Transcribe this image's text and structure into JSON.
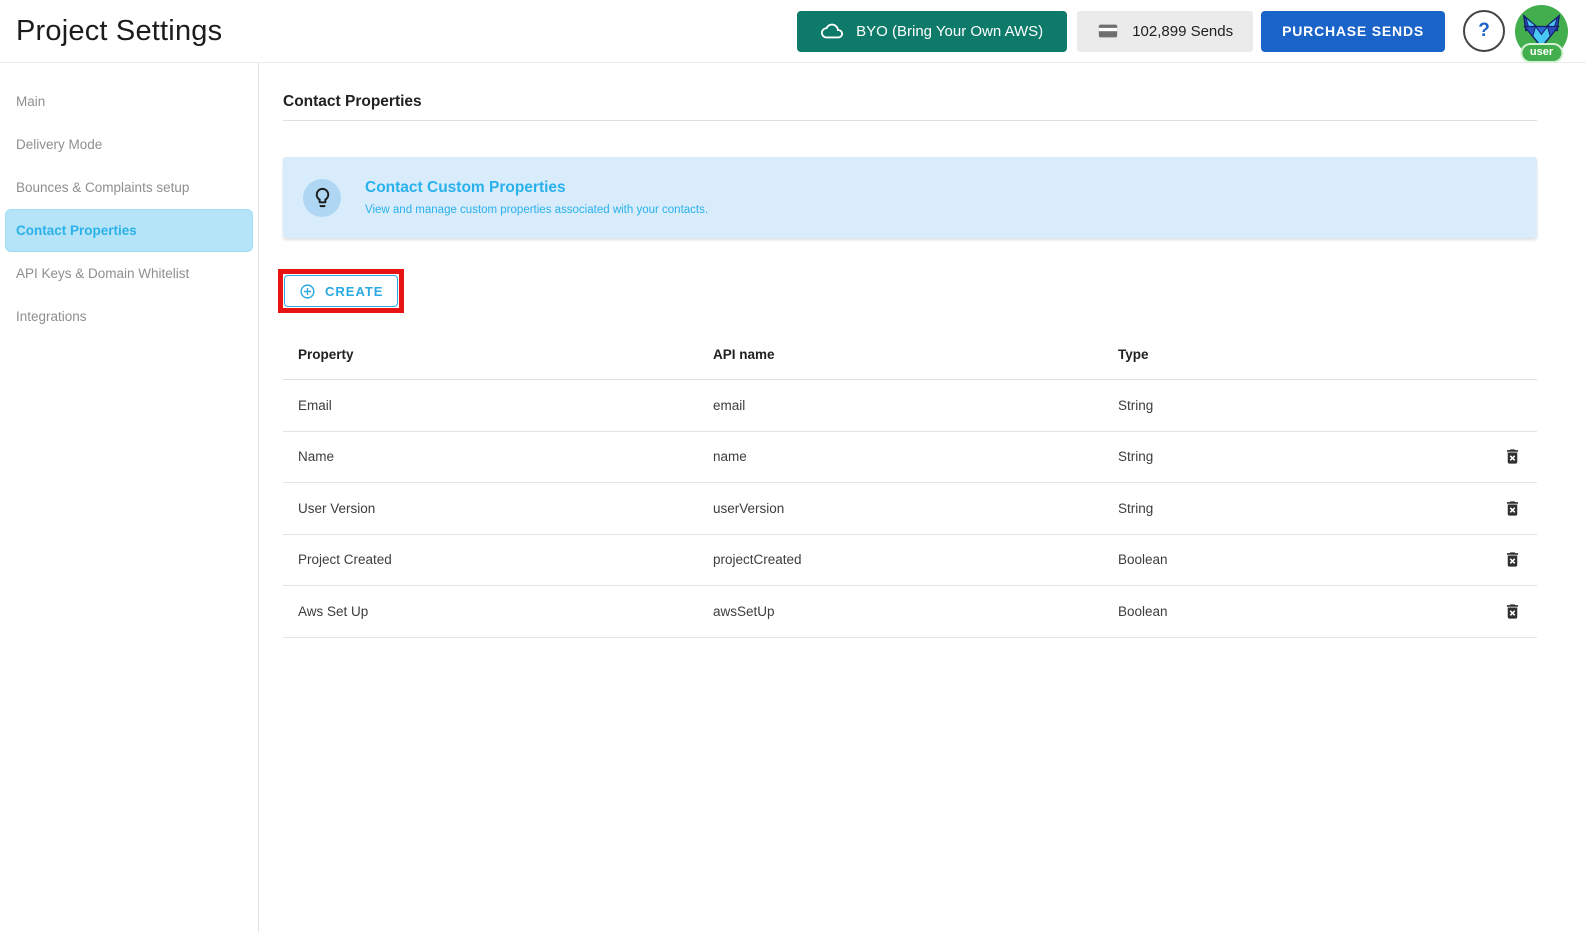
{
  "header": {
    "title": "Project Settings",
    "byo_label": "BYO (Bring Your Own AWS)",
    "sends_counter": "102,899 Sends",
    "purchase_label": "PURCHASE SENDS",
    "help_label": "?",
    "avatar_badge": "user"
  },
  "sidebar": {
    "items": [
      {
        "label": "Main",
        "active": false
      },
      {
        "label": "Delivery Mode",
        "active": false
      },
      {
        "label": "Bounces & Complaints setup",
        "active": false
      },
      {
        "label": "Contact Properties",
        "active": true
      },
      {
        "label": "API Keys & Domain Whitelist",
        "active": false
      },
      {
        "label": "Integrations",
        "active": false
      }
    ]
  },
  "main": {
    "page_heading": "Contact Properties",
    "banner": {
      "icon": "lightbulb-icon",
      "title": "Contact Custom Properties",
      "subtitle": "View and manage custom properties associated with your contacts."
    },
    "create_label": "CREATE",
    "table": {
      "columns": [
        "Property",
        "API name",
        "Type"
      ],
      "rows": [
        {
          "property": "Email",
          "api_name": "email",
          "type": "String",
          "deletable": false
        },
        {
          "property": "Name",
          "api_name": "name",
          "type": "String",
          "deletable": true
        },
        {
          "property": "User Version",
          "api_name": "userVersion",
          "type": "String",
          "deletable": true
        },
        {
          "property": "Project Created",
          "api_name": "projectCreated",
          "type": "Boolean",
          "deletable": true
        },
        {
          "property": "Aws Set Up",
          "api_name": "awsSetUp",
          "type": "Boolean",
          "deletable": true
        }
      ]
    }
  },
  "colors": {
    "accent_cyan": "#2aa9e3",
    "teal_button": "#0d7a6a",
    "blue_button": "#1a63c8",
    "banner_background": "#d9ecfb",
    "active_item_background": "#b5e3f8",
    "annotation_red": "#e81313",
    "avatar_green": "#43ae4d"
  }
}
